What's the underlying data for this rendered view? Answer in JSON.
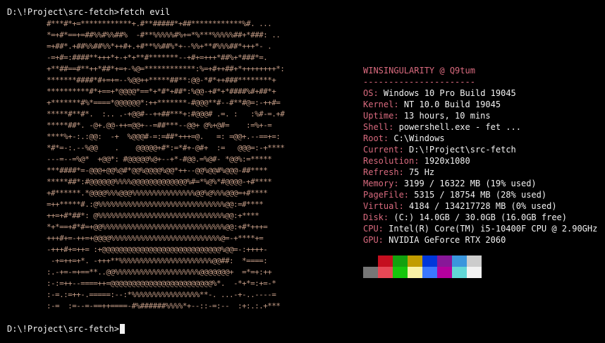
{
  "terminal": {
    "prompt": "D:\\!Project\\src-fetch>",
    "command": "fetch evil"
  },
  "ascii_art": [
    "#***#*+=************+.#**#####*+##************%#. ...",
    "*=+#*==+=##%%#%%##%  -#**%%%%%#%+=*%***%%%%%##+*###: ..",
    "=+##*.+##%%##%%*++#+.+#**%%##%*+--%%+**#%%%##*+++*- .",
    "-=+#=:####**+++*+-+*+**#*******--+#+=+++*##%+*###*=.",
    "+**##==#**++*##*+=+-%@=************:%=+#++##+*++++++++*:",
    "*******####*#+=+=--%@@++*****##**:@@-*#*++###********+",
    "**********#*+==+*@@@@*==*+*#*+##*:%@@-+#*+*####%#+##*+",
    "+*******#%*====*@@@@@@*:++*******-#@@@**#--#**#@=:-++#=",
    "*****#**#*.  :.. .-+@@#--++##***+:#@@@# .=. :   :%#-=.+#",
    "*****##*. -@+.@@-++=@@+--=##***--@@+ @%+@#=    :=%+-=",
    "****%+-:.:@@:  -+  %@@@#-=:=##*+++=@.   =: =@@+.--==+=:",
    "*#*=-:.--%@@    .    @@@@@+#*:=*#+-@#+  :=   @@@=:-+****",
    "---=--=%@*  +@@*: #@@@@@%@+--+*-#@@.=%@#- *@@%:=*****",
    "***####*=-@@@+@@%@#*@@%@@@@%@@*++--@@%@@#%@@@-##****",
    "*****##*:#@@@@@@%%%%@@@@@@@@@@@@@%#=*%@%*#@@@@-+#****",
    "+#******.*@@@@%%%@@@%%%%%%%%%%%%%%%@@%@%%%@@@=+#****",
    "=++*****#.:@%%%%%%%%%%%%%%%%%%%%%%%%%%%%%%@@:=#****",
    "++=+#*##*: @%%%%%%%%%%%%%%%%%%%%%%%%%%%%%%@@:+****",
    "*+*==+#*#=+@@%%%%%%%%%%%%%%%%%%%%%%%%%%%%%@@:+#*+++=",
    "+++#+=-++=+@@@@%%%%%%%%%%%%%%%%%%%%%%%%%%@=-+****+=",
    "-+++#+=++= :+@@@@@@@@@@@@@@@@@@@@@@@@@@@@%@@=-:++++-",
    " -+=++=+*. -+++**%%%%%%%%%%%%%%%%%%%%%%@@##:  *====:",
    ":.-+=-=+==**..@@%%%%%%%%%%%%%%%%%%%%@@@@@@@+  =*=+:++",
    ":-:=++--====++=@@@@@@@@@@@@@@@@@@@@@@@@%*.  -*+*=:+=-*",
    ":-=.:=++-.=====:--:*%%%%%%%%%%%%%%%%**-. ...-+-..----=",
    ":-=  :=--=-==++====-#%######%%%%*+--::-=:--  :+:.:.+***"
  ],
  "info": {
    "title": "WINSINGULARITY @ Q9tum",
    "separator": "----------------------",
    "rows": [
      {
        "label": "OS:",
        "value": "Windows 10 Pro Build 19045"
      },
      {
        "label": "Kernel:",
        "value": "NT 10.0 Build 19045"
      },
      {
        "label": "Uptime:",
        "value": "13 hours, 10 mins"
      },
      {
        "label": "Shell:",
        "value": "powershell.exe - fet ..."
      },
      {
        "label": "Root:",
        "value": "C:\\Windows"
      },
      {
        "label": "Current:",
        "value": "D:\\!Project\\src-fetch"
      },
      {
        "label": "Resolution:",
        "value": "1920x1080"
      },
      {
        "label": "Refresh:",
        "value": "75 Hz"
      },
      {
        "label": "Memory:",
        "value": "3199 / 16322 MB (19% used)"
      },
      {
        "label": "PageFile:",
        "value": "5315 / 18754 MB (28% used)"
      },
      {
        "label": "Virtual:",
        "value": "4184 / 134217728 MB (0% used)"
      },
      {
        "label": "Disk:",
        "value": "(C:) 14.0GB / 30.0GB (16.0GB free)"
      },
      {
        "label": "CPU:",
        "value": "Intel(R) Core(TM) i5-10400F CPU @ 2.90GHz"
      },
      {
        "label": "GPU:",
        "value": "NVIDIA GeForce RTX 2060"
      }
    ]
  },
  "palette": {
    "normal": [
      "#000000",
      "#c50f1f",
      "#13a10e",
      "#c19c00",
      "#0037da",
      "#881798",
      "#3a96dd",
      "#cccccc"
    ],
    "bright": [
      "#767676",
      "#e74856",
      "#16c60c",
      "#f9f1a5",
      "#3b78ff",
      "#b4009e",
      "#61d6d6",
      "#f2f2f2"
    ]
  },
  "colors": {
    "background": "#000000",
    "accent": "#d96a7e",
    "art": "#c49c86",
    "text": "#f2f2f2"
  }
}
